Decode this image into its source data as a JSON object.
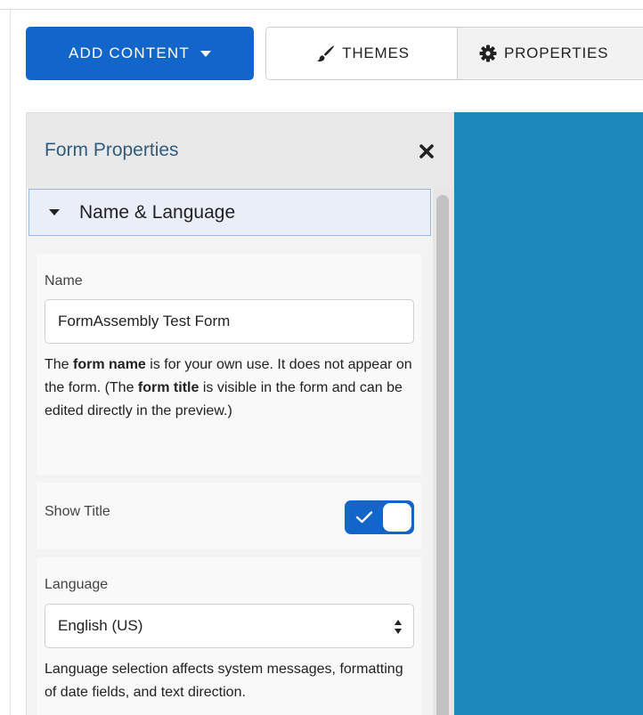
{
  "toolbar": {
    "add_content_label": "ADD CONTENT",
    "themes_label": "THEMES",
    "properties_label": "PROPERTIES"
  },
  "panel": {
    "title": "Form Properties",
    "section": "Name & Language",
    "name_field": {
      "label": "Name",
      "value": "FormAssembly Test Form",
      "help": {
        "p1": "The ",
        "b1": "form name",
        "p2": " is for your own use. It does not appear on the form. (The ",
        "b2": "form title",
        "p3": " is visible in the form and can be edited directly in the preview.)"
      }
    },
    "show_title": {
      "label": "Show Title",
      "enabled": true
    },
    "language": {
      "label": "Language",
      "selected": "English (US)",
      "help": "Language selection affects system messages, formatting of date fields, and text direction."
    }
  },
  "colors": {
    "primary": "#1265c9",
    "preview_background": "#1d88bb",
    "panel_title": "#335c7a"
  },
  "icons": {
    "add_content_caret": "caret-down-icon",
    "themes": "paintbrush-icon",
    "properties": "gear-icon",
    "close": "close-icon",
    "section_toggle": "caret-down-icon",
    "toggle_check": "checkmark-icon",
    "select_arrows": "sort-arrows-icon"
  }
}
